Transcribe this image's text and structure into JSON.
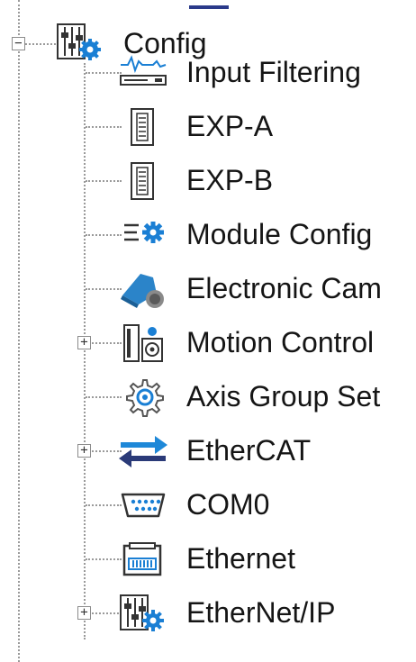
{
  "tree": {
    "root": {
      "label": "Config",
      "expander": "−",
      "icon": "mixer-sliders-gear-icon"
    },
    "children": [
      {
        "key": "input-filtering",
        "label": "Input Filtering",
        "icon": "input-filter-waveform-icon",
        "expander": ""
      },
      {
        "key": "exp-a",
        "label": "EXP-A",
        "icon": "expansion-module-icon",
        "expander": ""
      },
      {
        "key": "exp-b",
        "label": "EXP-B",
        "icon": "expansion-module-icon",
        "expander": ""
      },
      {
        "key": "module-config",
        "label": "Module Config",
        "icon": "list-gear-icon",
        "expander": ""
      },
      {
        "key": "electronic-cam",
        "label": "Electronic Cam",
        "icon": "cam-disc-icon",
        "expander": ""
      },
      {
        "key": "motion-control",
        "label": "Motion Control",
        "icon": "servo-drive-icon",
        "expander": "+"
      },
      {
        "key": "axis-group",
        "label": "Axis Group Set",
        "icon": "gear-icon",
        "expander": ""
      },
      {
        "key": "ethercat",
        "label": "EtherCAT",
        "icon": "bidirectional-arrows-icon",
        "expander": "+"
      },
      {
        "key": "com0",
        "label": "COM0",
        "icon": "serial-port-icon",
        "expander": ""
      },
      {
        "key": "ethernet",
        "label": "Ethernet",
        "icon": "ethernet-port-icon",
        "expander": ""
      },
      {
        "key": "ethernet-ip",
        "label": "EtherNet/IP",
        "icon": "mixer-sliders-gear-icon",
        "expander": "+"
      }
    ]
  },
  "colors": {
    "gear_blue": "#1a7fd4",
    "arrow_blue": "#1e88d8",
    "arrow_navy": "#2a3a78",
    "cam_blue": "#2b84c9",
    "icon_outline": "#333333"
  }
}
